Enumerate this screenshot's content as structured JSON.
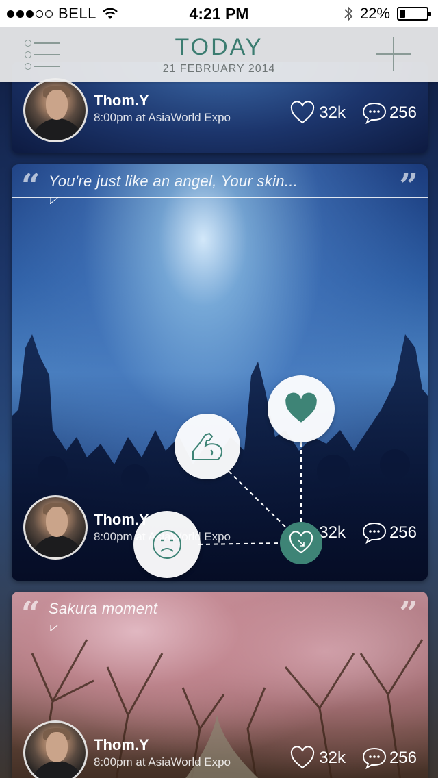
{
  "status_bar": {
    "carrier": "BELL",
    "time": "4:21 PM",
    "battery": "22%",
    "battery_level": 0.22
  },
  "nav": {
    "title": "TODAY",
    "date": "21 FEBRUARY 2014",
    "menu_icon": "menu-list-icon",
    "add_icon": "plus-icon"
  },
  "accent_color": "#3e8476",
  "cards": [
    {
      "author": "Thom.Y",
      "meta": "8:00pm at AsiaWorld Expo",
      "likes": "32k",
      "comments": "256"
    },
    {
      "quote": "You're just like an angel, Your skin...",
      "author": "Thom.Y",
      "meta": "8:00pm at AsiaWorld Expo",
      "likes": "32k",
      "comments": "256"
    },
    {
      "quote": "Sakura moment",
      "author": "Thom.Y",
      "meta": "8:00pm at AsiaWorld Expo",
      "likes": "32k",
      "comments": "256"
    }
  ],
  "reactions": {
    "love_icon": "heart-filled-icon",
    "strong_icon": "flexed-arm-icon",
    "sad_icon": "sad-face-icon",
    "anchor_icon": "heart-outline-icon"
  }
}
